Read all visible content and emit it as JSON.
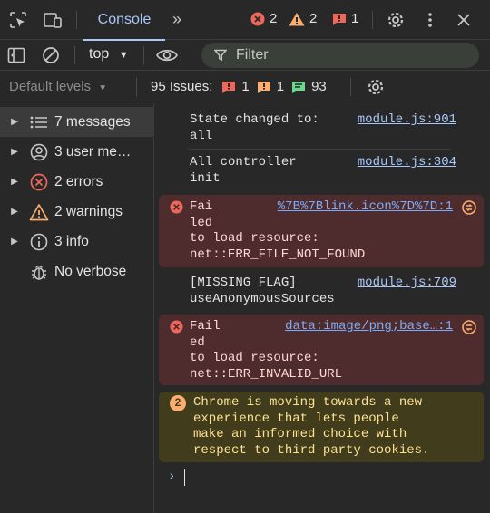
{
  "tabbar": {
    "console_label": "Console",
    "errors_count": "2",
    "warnings_count": "2",
    "issues_count": "1"
  },
  "toolbar": {
    "context": "top",
    "filter_placeholder": "Filter"
  },
  "levels": {
    "default_levels": "Default levels",
    "issues_label": "95 Issues:",
    "issue_error_count": "1",
    "issue_warning_count": "1",
    "issue_info_count": "93"
  },
  "sidebar": {
    "items": [
      {
        "label": "7 messages",
        "icon": "list-icon"
      },
      {
        "label": "3 user me…",
        "icon": "user-icon"
      },
      {
        "label": "2 errors",
        "icon": "error-icon"
      },
      {
        "label": "2 warnings",
        "icon": "warning-icon"
      },
      {
        "label": "3 info",
        "icon": "info-icon"
      },
      {
        "label": "No verbose",
        "icon": "bug-icon"
      }
    ]
  },
  "messages": [
    {
      "type": "log",
      "text": "State changed to:\nall",
      "source": "module.js:901"
    },
    {
      "type": "log",
      "text": "All controller\ninit",
      "source": "module.js:304"
    },
    {
      "type": "error",
      "text": "Fai\nled\nto load resource:\nnet::ERR_FILE_NOT_FOUND",
      "source": "%7B%7Blink.icon%7D%7D:1"
    },
    {
      "type": "log",
      "text": "[MISSING FLAG]\nuseAnonymousSources",
      "source": "module.js:709"
    },
    {
      "type": "error",
      "text": "Fail\ned\nto load resource:\nnet::ERR_INVALID_URL",
      "source": "data:image/png;base…:1"
    },
    {
      "type": "warning",
      "count": "2",
      "text": "Chrome is moving towards a new\nexperience that lets people\nmake an informed choice with\nrespect to third-party cookies."
    }
  ],
  "colors": {
    "accent": "#a8c7fa",
    "error": "#ee675c",
    "warning": "#fcad70"
  }
}
